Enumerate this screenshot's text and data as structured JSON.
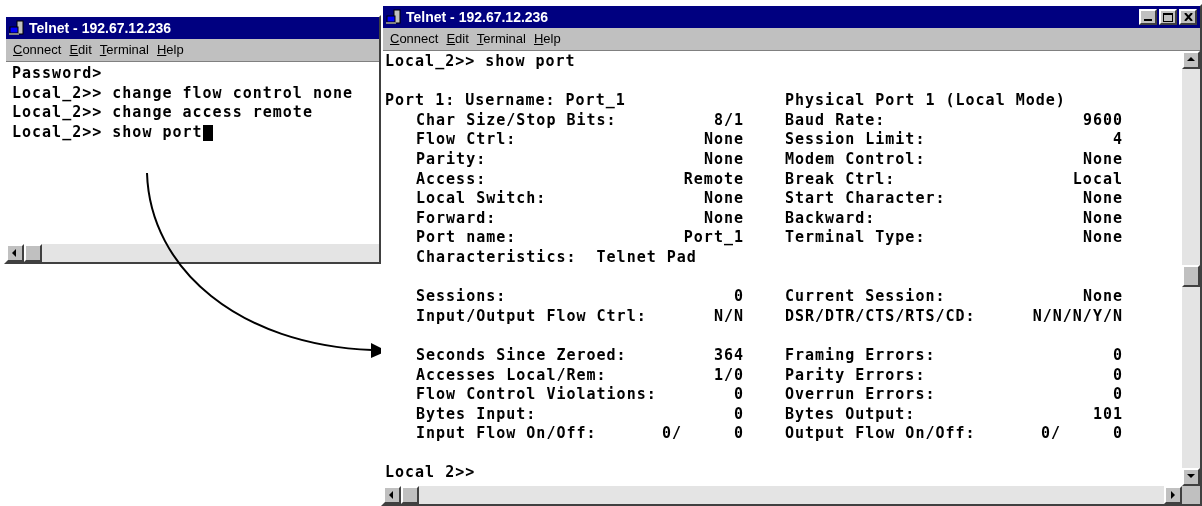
{
  "windows": [
    {
      "title": "Telnet - 192.67.12.236",
      "menu": [
        "Connect",
        "Edit",
        "Terminal",
        "Help"
      ],
      "cursor": true,
      "lines": [
        {
          "kind": "text",
          "text": "Password>"
        },
        {
          "kind": "text",
          "text": "Local_2>> change flow control none"
        },
        {
          "kind": "text",
          "text": "Local_2>> change access remote"
        },
        {
          "kind": "text",
          "text": "Local_2>> show port"
        }
      ]
    },
    {
      "title": "Telnet - 192.67.12.236",
      "menu": [
        "Connect",
        "Edit",
        "Terminal",
        "Help"
      ],
      "cursor": false,
      "lines": [
        {
          "kind": "text",
          "text": "Local_2>> show port"
        },
        {
          "kind": "blank"
        },
        {
          "kind": "heading",
          "left": "Port 1: Username: Port_1",
          "right": "Physical Port 1 (Local Mode)"
        },
        {
          "kind": "pair",
          "cells": [
            {
              "label": "Char Size/Stop Bits:",
              "values": [
                "8/1"
              ]
            },
            {
              "label": "Baud Rate:",
              "values": [
                "9600"
              ]
            }
          ]
        },
        {
          "kind": "pair",
          "cells": [
            {
              "label": "Flow Ctrl:",
              "values": [
                "None"
              ]
            },
            {
              "label": "Session Limit:",
              "values": [
                "4"
              ]
            }
          ]
        },
        {
          "kind": "pair",
          "cells": [
            {
              "label": "Parity:",
              "values": [
                "None"
              ]
            },
            {
              "label": "Modem Control:",
              "values": [
                "None"
              ]
            }
          ]
        },
        {
          "kind": "pair",
          "cells": [
            {
              "label": "Access:",
              "values": [
                "Remote"
              ]
            },
            {
              "label": "Break Ctrl:",
              "values": [
                "Local"
              ]
            }
          ]
        },
        {
          "kind": "pair",
          "cells": [
            {
              "label": "Local Switch:",
              "values": [
                "None"
              ]
            },
            {
              "label": "Start Character:",
              "values": [
                "None"
              ]
            }
          ]
        },
        {
          "kind": "pair",
          "cells": [
            {
              "label": "Forward:",
              "values": [
                "None"
              ]
            },
            {
              "label": "Backward:",
              "values": [
                "None"
              ]
            }
          ]
        },
        {
          "kind": "pair",
          "cells": [
            {
              "label": "Port name:",
              "values": [
                "Port_1"
              ]
            },
            {
              "label": "Terminal Type:",
              "values": [
                "None"
              ]
            }
          ]
        },
        {
          "kind": "indented",
          "text": "Characteristics:  Telnet Pad"
        },
        {
          "kind": "blank"
        },
        {
          "kind": "pair",
          "cells": [
            {
              "label": "Sessions:",
              "values": [
                "0"
              ]
            },
            {
              "label": "Current Session:",
              "values": [
                "None"
              ]
            }
          ]
        },
        {
          "kind": "pair",
          "cells": [
            {
              "label": "Input/Output Flow Ctrl:",
              "values": [
                "N/N"
              ]
            },
            {
              "label": "DSR/DTR/CTS/RTS/CD:",
              "values": [
                "N/N/N/Y/N"
              ]
            }
          ]
        },
        {
          "kind": "blank"
        },
        {
          "kind": "pair",
          "cells": [
            {
              "label": "Seconds Since Zeroed:",
              "values": [
                "364"
              ]
            },
            {
              "label": "Framing Errors:",
              "values": [
                "0"
              ]
            }
          ]
        },
        {
          "kind": "pair",
          "cells": [
            {
              "label": "Accesses Local/Rem:",
              "values": [
                "1/0"
              ]
            },
            {
              "label": "Parity Errors:",
              "values": [
                "0"
              ]
            }
          ]
        },
        {
          "kind": "pair",
          "cells": [
            {
              "label": "Flow Control Violations:",
              "values": [
                "0"
              ]
            },
            {
              "label": "Overrun Errors:",
              "values": [
                "0"
              ]
            }
          ]
        },
        {
          "kind": "pair",
          "cells": [
            {
              "label": "Bytes Input:",
              "values": [
                "0"
              ]
            },
            {
              "label": "Bytes Output:",
              "values": [
                "101"
              ]
            }
          ]
        },
        {
          "kind": "pair",
          "cells": [
            {
              "label": "Input Flow On/Off:",
              "values": [
                "0/",
                "0"
              ]
            },
            {
              "label": "Output Flow On/Off:",
              "values": [
                "0/",
                "0"
              ]
            }
          ]
        },
        {
          "kind": "blank"
        },
        {
          "kind": "text",
          "text": "Local 2>>"
        }
      ]
    }
  ]
}
